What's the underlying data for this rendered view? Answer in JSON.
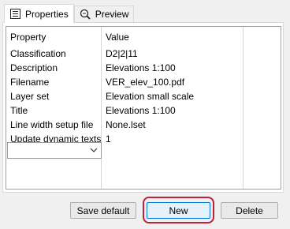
{
  "tabs": [
    {
      "label": "Properties",
      "icon": "properties-list-icon"
    },
    {
      "label": "Preview",
      "icon": "preview-magnifier-icon"
    }
  ],
  "table": {
    "columns": [
      "Property",
      "Value"
    ],
    "rows": [
      {
        "property": "Classification",
        "value": "D2|2|11"
      },
      {
        "property": "Description",
        "value": "Elevations 1:100"
      },
      {
        "property": "Filename",
        "value": "VER_elev_100.pdf"
      },
      {
        "property": "Layer set",
        "value": "Elevation small scale"
      },
      {
        "property": "Title",
        "value": "Elevations 1:100"
      },
      {
        "property": "Line width setup file",
        "value": "None.lset"
      },
      {
        "property": "Update dynamic texts",
        "value": "1"
      }
    ],
    "new_row_combo_value": ""
  },
  "buttons": {
    "save_default": "Save default",
    "new": "New",
    "delete": "Delete"
  },
  "colors": {
    "highlight_frame": "#c0213a",
    "focused_button_border": "#0078d7"
  }
}
